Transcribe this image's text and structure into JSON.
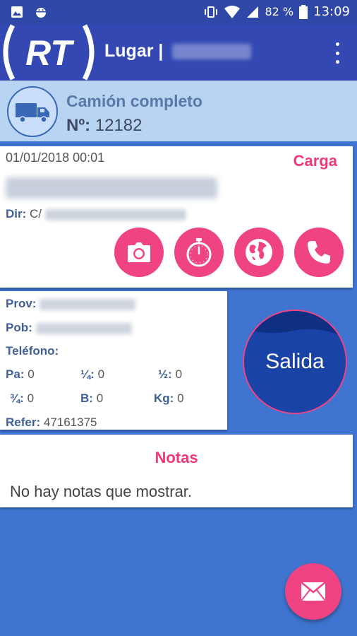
{
  "status_bar": {
    "battery": "82 %",
    "time": "13:09",
    "icons": [
      "image-icon",
      "android-debug-icon",
      "vibrate-icon",
      "wifi-icon",
      "signal-icon",
      "battery-icon"
    ]
  },
  "app_bar": {
    "logo_text": "RT",
    "title": "Lugar |",
    "menu_icon": "overflow-menu-icon"
  },
  "shipment": {
    "type": "Camión completo",
    "number_label": "Nº:",
    "number": "12182"
  },
  "stop": {
    "datetime": "01/01/2018 00:01",
    "kind": "Carga",
    "dir_label": "Dir:",
    "dir_prefix": "C/",
    "actions": [
      "camera-icon",
      "stopwatch-icon",
      "globe-icon",
      "phone-icon"
    ]
  },
  "details": {
    "prov_label": "Prov:",
    "pob_label": "Pob:",
    "tel_label": "Teléfono:",
    "pa_label": "Pa:",
    "pa_value": "0",
    "q1_label": "¼:",
    "q1_value": "0",
    "half_label": "½:",
    "half_value": "0",
    "q3_label": "¾:",
    "q3_value": "0",
    "b_label": "B:",
    "b_value": "0",
    "kg_label": "Kg:",
    "kg_value": "0",
    "refer_label": "Refer:",
    "refer_value": "47161375"
  },
  "salida_button": "Salida",
  "notes": {
    "title": "Notas",
    "empty_text": "No hay notas que mostrar."
  },
  "fab_icon": "mail-icon",
  "colors": {
    "background": "#3f75d0",
    "app_bar": "#3448b3",
    "accent": "#f04384",
    "header": "#b8d4f2",
    "salida": "#1a43a8"
  }
}
